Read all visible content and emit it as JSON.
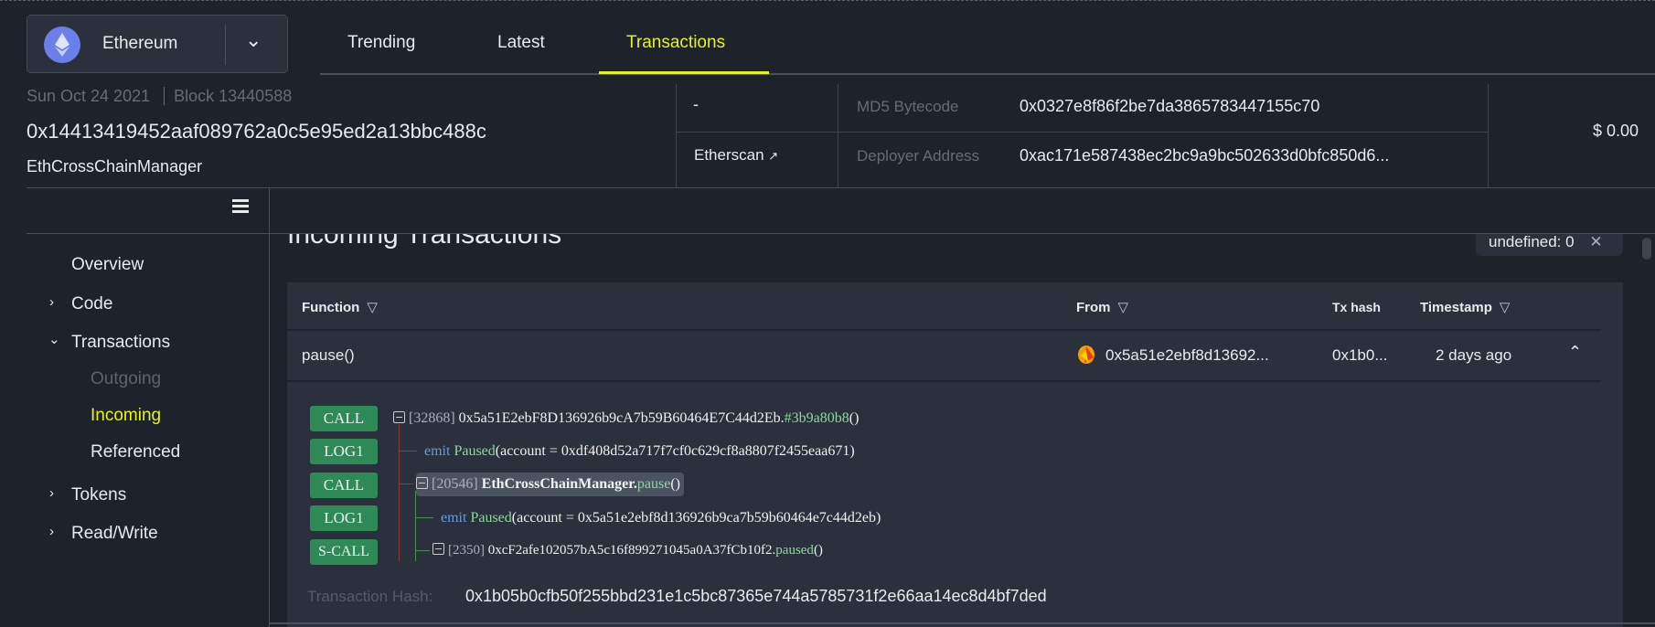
{
  "network": {
    "name": "Ethereum",
    "icon": "ethereum-icon"
  },
  "tabs": [
    {
      "label": "Trending"
    },
    {
      "label": "Latest"
    },
    {
      "label": "Transactions",
      "active": true
    }
  ],
  "contract": {
    "date": "Sun Oct 24 2021",
    "block": "Block 13440588",
    "address": "0x14413419452aaf089762a0c5e95ed2a13bbc488c",
    "name": "EthCrossChainManager"
  },
  "links": {
    "dash": "-",
    "etherscan": "Etherscan"
  },
  "details": {
    "md5_label": "MD5 Bytecode",
    "md5_value": "0x0327e8f86f2be7da3865783447155c70",
    "deployer_label": "Deployer Address",
    "deployer_value": "0xac171e587438ec2bc9a9bc502633d0bfc850d6..."
  },
  "balance": "$ 0.00",
  "sidebar": {
    "items": [
      {
        "label": "Overview"
      },
      {
        "label": "Code"
      },
      {
        "label": "Transactions"
      },
      {
        "label": "Outgoing"
      },
      {
        "label": "Incoming"
      },
      {
        "label": "Referenced"
      },
      {
        "label": "Tokens"
      },
      {
        "label": "Read/Write"
      }
    ]
  },
  "main": {
    "title": "Incoming Transactions",
    "filter_chip": "undefined: 0",
    "columns": [
      "Function",
      "From",
      "Tx hash",
      "Timestamp"
    ],
    "row": {
      "function": "pause()",
      "from": "0x5a51e2ebf8d13692...",
      "tx_hash": "0x1b0...",
      "timestamp": "2 days ago"
    },
    "trace": {
      "badges": [
        "CALL",
        "LOG1",
        "CALL",
        "LOG1",
        "S-CALL"
      ],
      "l1": {
        "gas": "[32868]",
        "addr": "0x5a51E2ebF8D136926b9cA7b59B60464E7C44d2Eb.",
        "fn": "#3b9a80b8",
        "tail": "()"
      },
      "l2": {
        "emit": "emit",
        "event": "Paused",
        "args": "(account = 0xdf408d52a717f7cf0c629cf8a8807f2455eaa671)"
      },
      "l3": {
        "gas": "[20546]",
        "addr": "EthCrossChainManager.",
        "fn": "pause",
        "tail": "()"
      },
      "l4": {
        "emit": "emit",
        "event": "Paused",
        "args": "(account = 0x5a51e2ebf8d136926b9ca7b59b60464e7c44d2eb)"
      },
      "l5": {
        "gas": "[2350]",
        "addr": "0xcF2afe102057bA5c16f899271045a0A37fCb10f2.",
        "fn": "paused",
        "tail": "()"
      }
    },
    "tx_hash_label": "Transaction Hash:",
    "tx_hash_value": "0x1b05b0cfb50f255bbd231e1c5bc87365e744a5785731f2e66aa14ec8d4bf7ded"
  }
}
